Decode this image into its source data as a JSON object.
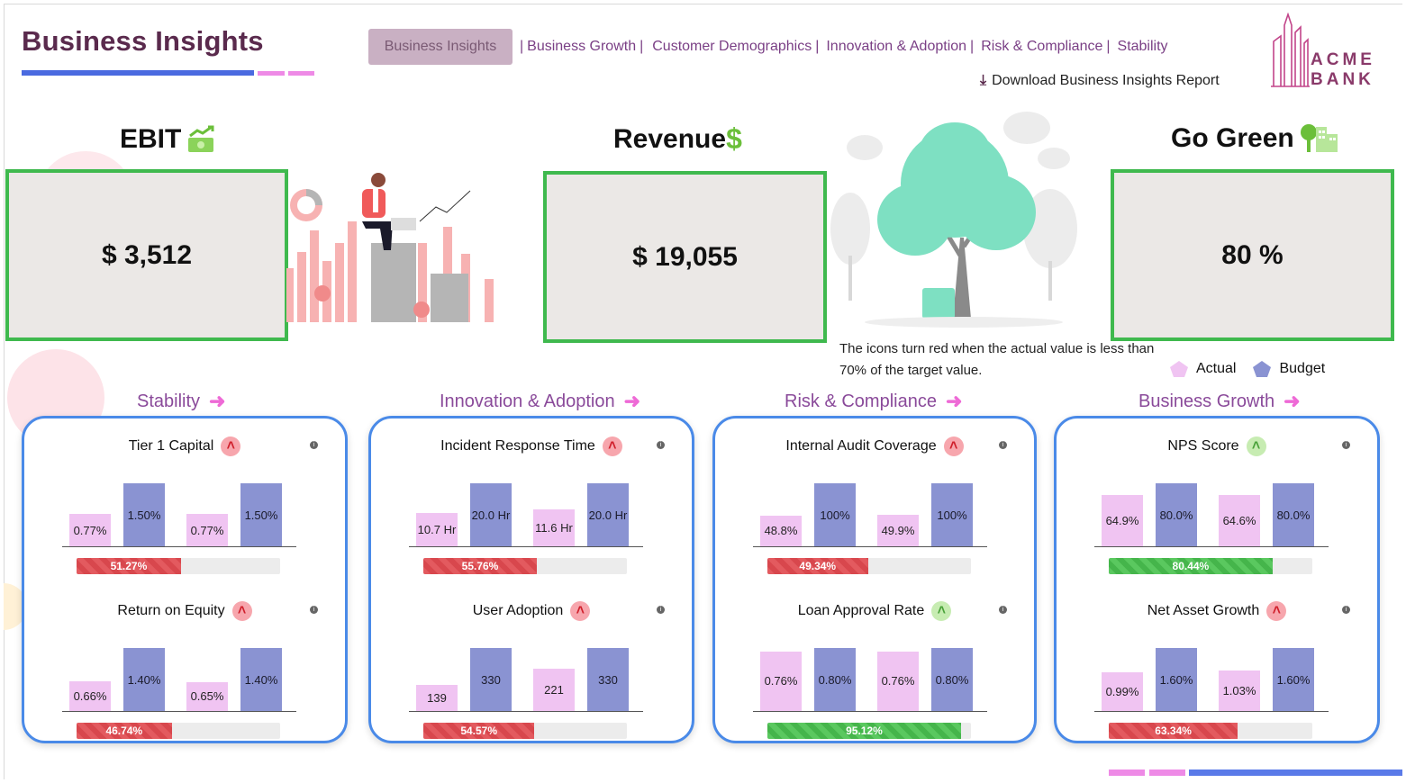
{
  "header": {
    "title": "Business Insights",
    "nav": {
      "active": "Business Insights",
      "items": [
        "Business Growth",
        "Customer Demographics",
        "Innovation & Adoption",
        "Risk & Compliance",
        "Stability"
      ],
      "separator": "|"
    },
    "download_label": "Download Business Insights Report",
    "logo": {
      "line1": "ACME",
      "line2": "BANK"
    }
  },
  "kpis": {
    "ebit": {
      "label": "EBIT",
      "value": "$ 3,512",
      "icon": "money-growth-icon"
    },
    "revenue": {
      "label": "Revenue",
      "value": "$ 19,055",
      "icon": "dollar-icon"
    },
    "go_green": {
      "label": "Go Green",
      "value": "80 %",
      "icon": "tree-building-icon"
    }
  },
  "note": "The icons turn red when the actual value is less than 70% of the target value.",
  "legend": {
    "actual": "Actual",
    "budget": "Budget"
  },
  "colors": {
    "actual": "#f0c4f2",
    "budget": "#8a93d2",
    "card_border": "#4a8ae8",
    "kpi_border": "#3fb94e",
    "red": "#e35a5f",
    "green": "#5ac85f"
  },
  "sections": [
    {
      "title": "Stability",
      "metrics": [
        {
          "name": "Tier 1 Capital",
          "status": "red",
          "bars": [
            {
              "label": "0.77%",
              "v": 0.77,
              "t": "actual"
            },
            {
              "label": "1.50%",
              "v": 1.5,
              "t": "budget"
            },
            {
              "label": "0.77%",
              "v": 0.77,
              "t": "actual"
            },
            {
              "label": "1.50%",
              "v": 1.5,
              "t": "budget"
            }
          ],
          "progress": {
            "label": "51.27%",
            "value": 51.27,
            "status": "red"
          }
        },
        {
          "name": "Return on Equity",
          "status": "red",
          "bars": [
            {
              "label": "0.66%",
              "v": 0.66,
              "t": "actual"
            },
            {
              "label": "1.40%",
              "v": 1.4,
              "t": "budget"
            },
            {
              "label": "0.65%",
              "v": 0.65,
              "t": "actual"
            },
            {
              "label": "1.40%",
              "v": 1.4,
              "t": "budget"
            }
          ],
          "progress": {
            "label": "46.74%",
            "value": 46.74,
            "status": "red"
          }
        }
      ]
    },
    {
      "title": "Innovation & Adoption",
      "metrics": [
        {
          "name": "Incident Response Time",
          "status": "red",
          "bars": [
            {
              "label": "10.7 Hr",
              "v": 10.7,
              "t": "actual"
            },
            {
              "label": "20.0 Hr",
              "v": 20.0,
              "t": "budget"
            },
            {
              "label": "11.6 Hr",
              "v": 11.6,
              "t": "actual"
            },
            {
              "label": "20.0 Hr",
              "v": 20.0,
              "t": "budget"
            }
          ],
          "progress": {
            "label": "55.76%",
            "value": 55.76,
            "status": "red"
          }
        },
        {
          "name": "User Adoption",
          "status": "red",
          "bars": [
            {
              "label": "139",
              "v": 139,
              "t": "actual"
            },
            {
              "label": "330",
              "v": 330,
              "t": "budget"
            },
            {
              "label": "221",
              "v": 221,
              "t": "actual"
            },
            {
              "label": "330",
              "v": 330,
              "t": "budget"
            }
          ],
          "progress": {
            "label": "54.57%",
            "value": 54.57,
            "status": "red"
          }
        }
      ]
    },
    {
      "title": "Risk & Compliance",
      "metrics": [
        {
          "name": "Internal Audit Coverage",
          "status": "red",
          "bars": [
            {
              "label": "48.8%",
              "v": 48.8,
              "t": "actual"
            },
            {
              "label": "100%",
              "v": 100,
              "t": "budget"
            },
            {
              "label": "49.9%",
              "v": 49.9,
              "t": "actual"
            },
            {
              "label": "100%",
              "v": 100,
              "t": "budget"
            }
          ],
          "progress": {
            "label": "49.34%",
            "value": 49.34,
            "status": "red"
          }
        },
        {
          "name": "Loan Approval Rate",
          "status": "green",
          "bars": [
            {
              "label": "0.76%",
              "v": 0.76,
              "t": "actual"
            },
            {
              "label": "0.80%",
              "v": 0.8,
              "t": "budget"
            },
            {
              "label": "0.76%",
              "v": 0.76,
              "t": "actual"
            },
            {
              "label": "0.80%",
              "v": 0.8,
              "t": "budget"
            }
          ],
          "progress": {
            "label": "95.12%",
            "value": 95.12,
            "status": "green"
          }
        }
      ]
    },
    {
      "title": "Business Growth",
      "metrics": [
        {
          "name": "NPS Score",
          "status": "green",
          "bars": [
            {
              "label": "64.9%",
              "v": 64.9,
              "t": "actual"
            },
            {
              "label": "80.0%",
              "v": 80.0,
              "t": "budget"
            },
            {
              "label": "64.6%",
              "v": 64.6,
              "t": "actual"
            },
            {
              "label": "80.0%",
              "v": 80.0,
              "t": "budget"
            }
          ],
          "progress": {
            "label": "80.44%",
            "value": 80.44,
            "status": "green"
          }
        },
        {
          "name": "Net Asset Growth",
          "status": "red",
          "bars": [
            {
              "label": "0.99%",
              "v": 0.99,
              "t": "actual"
            },
            {
              "label": "1.60%",
              "v": 1.6,
              "t": "budget"
            },
            {
              "label": "1.03%",
              "v": 1.03,
              "t": "actual"
            },
            {
              "label": "1.60%",
              "v": 1.6,
              "t": "budget"
            }
          ],
          "progress": {
            "label": "63.34%",
            "value": 63.34,
            "status": "red"
          }
        }
      ]
    }
  ]
}
